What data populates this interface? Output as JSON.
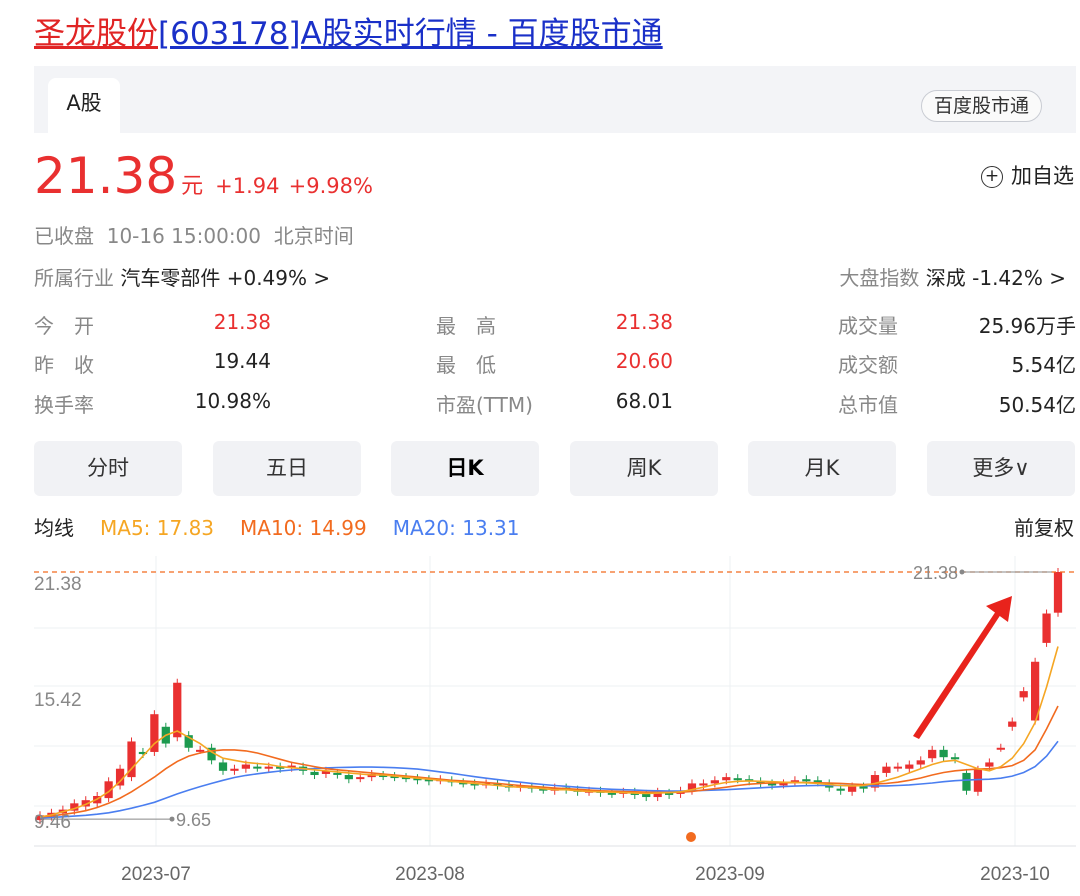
{
  "page": {
    "title_name": "圣龙股份",
    "title_rest": "[603178]A股实时行情 - 百度股市通"
  },
  "tabs": {
    "active": "A股",
    "source_badge": "百度股市通"
  },
  "quote": {
    "price": "21.38",
    "unit": "元",
    "change": "+1.94",
    "change_pct": "+9.98%",
    "add_watch": "加自选",
    "status": "已收盘  10-16 15:00:00  北京时间",
    "industry_label": "所属行业",
    "industry_value": "汽车零部件 +0.49% >",
    "index_label": "大盘指数",
    "index_value": "深成 -1.42% >",
    "open_label": "今　开",
    "open": "21.38",
    "prev_label": "昨　收",
    "prev": "19.44",
    "turnover_label": "换手率",
    "turnover": "10.98%",
    "high_label": "最　高",
    "high": "21.38",
    "low_label": "最　低",
    "low": "20.60",
    "pe_label": "市盈(TTM)",
    "pe": "68.01",
    "volume_label": "成交量",
    "volume": "25.96万手",
    "amount_label": "成交额",
    "amount": "5.54亿",
    "mktcap_label": "总市值",
    "mktcap": "50.54亿"
  },
  "periods": [
    "分时",
    "五日",
    "日K",
    "周K",
    "月K",
    "更多∨"
  ],
  "active_period": "日K",
  "ma": {
    "label": "均线",
    "ma5": "MA5: 17.83",
    "ma10": "MA10: 14.99",
    "ma20": "MA20: 13.31",
    "adjust": "前复权"
  },
  "colors": {
    "up": "#e93030",
    "down": "#1c9a4f",
    "ma5": "#f5a623",
    "ma10": "#f26b1f",
    "ma20": "#4a7ef0",
    "title_link": "#1a30c8"
  },
  "chart_data": {
    "type": "candlestick",
    "y_labels": [
      "21.38",
      "15.42",
      "9.46"
    ],
    "ylim": [
      9.46,
      21.38
    ],
    "x_ticks": [
      "2023-07",
      "2023-08",
      "2023-09",
      "2023-10"
    ],
    "max_marker": "21.38",
    "min_marker": "9.65",
    "candles": [
      [
        9.55,
        9.78
      ],
      [
        9.72,
        9.9
      ],
      [
        9.88,
        10.05
      ],
      [
        10.0,
        10.35
      ],
      [
        10.2,
        10.5
      ],
      [
        10.35,
        10.7
      ],
      [
        10.6,
        11.4
      ],
      [
        11.2,
        12.0
      ],
      [
        11.6,
        13.3
      ],
      [
        12.8,
        12.7
      ],
      [
        12.8,
        14.6
      ],
      [
        14.0,
        13.2
      ],
      [
        13.5,
        16.1
      ],
      [
        13.6,
        13.0
      ],
      [
        12.9,
        12.9
      ],
      [
        13.0,
        12.4
      ],
      [
        12.3,
        11.9
      ],
      [
        11.9,
        12.0
      ],
      [
        12.0,
        12.2
      ],
      [
        12.1,
        12.05
      ],
      [
        12.0,
        12.1
      ],
      [
        12.1,
        12.0
      ],
      [
        12.05,
        12.15
      ],
      [
        12.1,
        11.9
      ],
      [
        11.85,
        11.7
      ],
      [
        11.75,
        11.9
      ],
      [
        11.8,
        11.72
      ],
      [
        11.7,
        11.5
      ],
      [
        11.55,
        11.6
      ],
      [
        11.6,
        11.75
      ],
      [
        11.7,
        11.65
      ],
      [
        11.65,
        11.6
      ],
      [
        11.6,
        11.55
      ],
      [
        11.55,
        11.45
      ],
      [
        11.5,
        11.4
      ],
      [
        11.45,
        11.5
      ],
      [
        11.45,
        11.35
      ],
      [
        11.35,
        11.3
      ],
      [
        11.3,
        11.2
      ],
      [
        11.25,
        11.3
      ],
      [
        11.3,
        11.2
      ],
      [
        11.2,
        11.1
      ],
      [
        11.1,
        11.2
      ],
      [
        11.15,
        11.05
      ],
      [
        11.05,
        11.0
      ],
      [
        10.95,
        11.1
      ],
      [
        11.1,
        11.0
      ],
      [
        11.0,
        10.9
      ],
      [
        10.9,
        10.95
      ],
      [
        10.95,
        10.85
      ],
      [
        10.85,
        10.8
      ],
      [
        10.8,
        10.9
      ],
      [
        10.9,
        10.75
      ],
      [
        10.8,
        10.65
      ],
      [
        10.65,
        10.9
      ],
      [
        10.85,
        10.75
      ],
      [
        10.8,
        10.95
      ],
      [
        10.95,
        11.3
      ],
      [
        11.2,
        11.3
      ],
      [
        11.3,
        11.45
      ],
      [
        11.45,
        11.6
      ],
      [
        11.55,
        11.5
      ],
      [
        11.5,
        11.4
      ],
      [
        11.4,
        11.3
      ],
      [
        11.3,
        11.2
      ],
      [
        11.25,
        11.3
      ],
      [
        11.35,
        11.45
      ],
      [
        11.5,
        11.4
      ],
      [
        11.45,
        11.35
      ],
      [
        11.3,
        11.1
      ],
      [
        11.05,
        10.95
      ],
      [
        10.9,
        11.15
      ],
      [
        11.15,
        11.05
      ],
      [
        11.1,
        11.7
      ],
      [
        11.8,
        12.1
      ],
      [
        12.05,
        12.1
      ],
      [
        12.0,
        12.2
      ],
      [
        12.2,
        12.4
      ],
      [
        12.5,
        12.9
      ],
      [
        12.9,
        12.55
      ],
      [
        12.55,
        12.45
      ],
      [
        11.8,
        10.95
      ],
      [
        10.9,
        11.95
      ],
      [
        12.1,
        12.3
      ],
      [
        13.0,
        13.0
      ],
      [
        14.0,
        14.25
      ],
      [
        15.4,
        15.7
      ],
      [
        14.3,
        17.1
      ],
      [
        18.0,
        19.4
      ],
      [
        19.44,
        21.38
      ]
    ],
    "ma5": [
      9.7,
      9.8,
      9.95,
      10.1,
      10.3,
      10.55,
      10.9,
      11.4,
      12.0,
      12.6,
      13.2,
      13.6,
      13.8,
      13.5,
      13.2,
      12.8,
      12.5,
      12.4,
      12.3,
      12.25,
      12.2,
      12.1,
      12.05,
      12.0,
      11.95,
      11.9,
      11.85,
      11.8,
      11.75,
      11.7,
      11.7,
      11.65,
      11.6,
      11.55,
      11.5,
      11.45,
      11.4,
      11.35,
      11.3,
      11.25,
      11.2,
      11.15,
      11.12,
      11.1,
      11.05,
      11.0,
      11.0,
      10.95,
      10.92,
      10.9,
      10.88,
      10.86,
      10.84,
      10.82,
      10.84,
      10.86,
      10.9,
      11.0,
      11.12,
      11.25,
      11.35,
      11.4,
      11.42,
      11.4,
      11.38,
      11.36,
      11.35,
      11.33,
      11.3,
      11.25,
      11.2,
      11.18,
      11.2,
      11.3,
      11.45,
      11.6,
      11.8,
      12.0,
      12.2,
      12.35,
      12.4,
      12.2,
      12.0,
      11.9,
      12.1,
      12.5,
      13.2,
      14.2,
      15.9,
      17.83
    ],
    "ma10": [
      9.7,
      9.75,
      9.82,
      9.9,
      10.0,
      10.15,
      10.35,
      10.6,
      10.9,
      11.25,
      11.6,
      12.0,
      12.35,
      12.6,
      12.75,
      12.85,
      12.9,
      12.9,
      12.85,
      12.75,
      12.6,
      12.45,
      12.3,
      12.2,
      12.1,
      12.0,
      11.95,
      11.9,
      11.85,
      11.8,
      11.75,
      11.7,
      11.65,
      11.6,
      11.55,
      11.5,
      11.45,
      11.42,
      11.38,
      11.34,
      11.3,
      11.25,
      11.2,
      11.16,
      11.12,
      11.08,
      11.05,
      11.02,
      10.98,
      10.95,
      10.93,
      10.91,
      10.9,
      10.88,
      10.87,
      10.87,
      10.88,
      10.92,
      10.98,
      11.05,
      11.12,
      11.2,
      11.26,
      11.3,
      11.32,
      11.33,
      11.34,
      11.34,
      11.33,
      11.32,
      11.3,
      11.27,
      11.25,
      11.27,
      11.3,
      11.36,
      11.45,
      11.56,
      11.7,
      11.82,
      11.9,
      11.95,
      11.98,
      12.0,
      12.05,
      12.15,
      12.4,
      12.9,
      13.9,
      14.99
    ],
    "ma20": [
      9.65,
      9.68,
      9.71,
      9.74,
      9.78,
      9.83,
      9.9,
      10.0,
      10.12,
      10.25,
      10.4,
      10.6,
      10.8,
      10.98,
      11.15,
      11.3,
      11.45,
      11.58,
      11.68,
      11.76,
      11.83,
      11.89,
      11.94,
      11.98,
      12.01,
      12.04,
      12.06,
      12.07,
      12.08,
      12.08,
      12.07,
      12.05,
      12.02,
      11.98,
      11.92,
      11.85,
      11.78,
      11.7,
      11.62,
      11.55,
      11.48,
      11.42,
      11.36,
      11.3,
      11.25,
      11.2,
      11.16,
      11.12,
      11.08,
      11.05,
      11.02,
      11.0,
      10.98,
      10.96,
      10.95,
      10.94,
      10.94,
      10.95,
      10.96,
      10.98,
      11.0,
      11.03,
      11.06,
      11.09,
      11.12,
      11.15,
      11.17,
      11.19,
      11.2,
      11.2,
      11.2,
      11.2,
      11.19,
      11.18,
      11.18,
      11.2,
      11.23,
      11.27,
      11.32,
      11.38,
      11.43,
      11.46,
      11.48,
      11.5,
      11.55,
      11.65,
      11.82,
      12.1,
      12.6,
      13.31
    ]
  }
}
